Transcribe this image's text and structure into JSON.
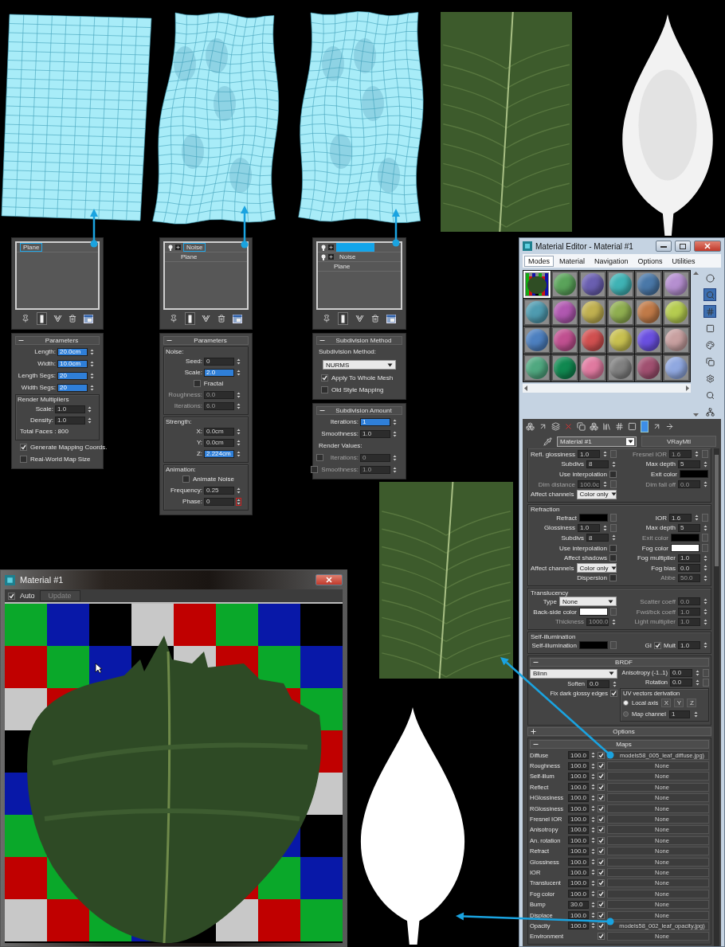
{
  "modifier_panels": [
    {
      "stack": [
        {
          "label": "Plane",
          "selected": true,
          "toggles": false
        }
      ],
      "rollouts": [
        {
          "title": "Parameters",
          "expanded": true,
          "rows": [
            {
              "kind": "spinner",
              "label": "Length:",
              "value": "20.0cm",
              "highlighted": true
            },
            {
              "kind": "spinner",
              "label": "Width:",
              "value": "10.0cm",
              "highlighted": true
            },
            {
              "kind": "spinner",
              "label": "Length Segs:",
              "value": "20",
              "highlighted": true
            },
            {
              "kind": "spinner",
              "label": "Width Segs:",
              "value": "20",
              "highlighted": true
            },
            {
              "kind": "group",
              "title": "Render Multipliers",
              "rows": [
                {
                  "kind": "spinner",
                  "label": "Scale:",
                  "value": "1.0",
                  "highlighted": false
                },
                {
                  "kind": "spinner",
                  "label": "Density:",
                  "value": "1.0",
                  "highlighted": false
                },
                {
                  "kind": "text",
                  "label": "Total Faces : 800"
                }
              ]
            },
            {
              "kind": "check",
              "label": "Generate Mapping Coords.",
              "checked": true
            },
            {
              "kind": "check",
              "label": "Real-World Map Size",
              "checked": false
            }
          ]
        }
      ]
    },
    {
      "stack": [
        {
          "label": "Noise",
          "selected": true,
          "toggles": true
        },
        {
          "label": "Plane",
          "selected": false,
          "toggles": false
        }
      ],
      "rollouts": [
        {
          "title": "Parameters",
          "expanded": true,
          "rows": [
            {
              "kind": "group",
              "title": "Noise:",
              "rows": [
                {
                  "kind": "spinner",
                  "label": "Seed:",
                  "value": "0",
                  "highlighted": false
                },
                {
                  "kind": "spinner",
                  "label": "Scale:",
                  "value": "2.0",
                  "highlighted": true
                },
                {
                  "kind": "check",
                  "label": "Fractal",
                  "checked": false
                },
                {
                  "kind": "spinner",
                  "label": "Roughness:",
                  "value": "0.0",
                  "highlighted": false,
                  "disabled": true
                },
                {
                  "kind": "spinner",
                  "label": "Iterations:",
                  "value": "6.0",
                  "highlighted": false,
                  "disabled": true
                }
              ]
            },
            {
              "kind": "group",
              "title": "Strength:",
              "rows": [
                {
                  "kind": "spinner",
                  "label": "X:",
                  "value": "0.0cm",
                  "highlighted": false
                },
                {
                  "kind": "spinner",
                  "label": "Y:",
                  "value": "0.0cm",
                  "highlighted": false
                },
                {
                  "kind": "spinner",
                  "label": "Z:",
                  "value": "2.224cm",
                  "highlighted": true
                }
              ]
            },
            {
              "kind": "group",
              "title": "Animation:",
              "rows": [
                {
                  "kind": "check",
                  "label": "Animate Noise",
                  "checked": false
                },
                {
                  "kind": "spinner",
                  "label": "Frequency:",
                  "value": "0.25",
                  "highlighted": false
                },
                {
                  "kind": "spinner",
                  "label": "Phase:",
                  "value": "0",
                  "highlighted": false,
                  "keyed": true
                }
              ]
            }
          ]
        }
      ]
    },
    {
      "stack": [
        {
          "selected": true,
          "toggles": true
        },
        {
          "label": "Noise",
          "selected": false,
          "toggles": true
        },
        {
          "label": "Plane",
          "selected": false,
          "toggles": false
        }
      ],
      "rollouts": [
        {
          "title": "Subdivision Method",
          "expanded": true,
          "rows": [
            {
              "kind": "text",
              "label": "Subdivision Method:"
            },
            {
              "kind": "dropdown",
              "value": "NURMS"
            },
            {
              "kind": "check",
              "label": "Apply To Whole Mesh",
              "checked": true
            },
            {
              "kind": "check",
              "label": "Old Style Mapping",
              "checked": false
            }
          ]
        },
        {
          "title": "Subdivision Amount",
          "expanded": true,
          "rows": [
            {
              "kind": "spinner",
              "label": "Iterations:",
              "value": "1",
              "highlighted": true
            },
            {
              "kind": "spinner",
              "label": "Smoothness:",
              "value": "1.0",
              "highlighted": false
            },
            {
              "kind": "text",
              "label": "Render Values:"
            },
            {
              "kind": "check-spinner",
              "checked": false,
              "label": "Iterations:",
              "value": "0",
              "disabled": true
            },
            {
              "kind": "check-spinner",
              "checked": false,
              "label": "Smoothness:",
              "value": "1.0",
              "disabled": true
            }
          ]
        }
      ]
    }
  ],
  "material_editor": {
    "title": "Material Editor - Material #1",
    "menu": [
      {
        "label": "Modes",
        "selected": true
      },
      {
        "label": "Material",
        "selected": false
      },
      {
        "label": "Navigation",
        "selected": false
      },
      {
        "label": "Options",
        "selected": false
      },
      {
        "label": "Utilities",
        "selected": false
      }
    ],
    "slots": [
      {
        "kind": "leaf",
        "selected": true
      },
      {
        "kind": "sphere",
        "color": "#5aa35a",
        "selected": false
      },
      {
        "kind": "sphere",
        "color": "#6a5fb0",
        "selected": false
      },
      {
        "kind": "sphere",
        "color": "#3fb3b5",
        "selected": false
      },
      {
        "kind": "sphere",
        "color": "#4a78a8",
        "selected": false
      },
      {
        "kind": "sphere",
        "color": "#b58fd0",
        "selected": false
      },
      {
        "kind": "sphere",
        "color": "#4f9bb0",
        "selected": false
      },
      {
        "kind": "sphere",
        "color": "#b058b0",
        "selected": false
      },
      {
        "kind": "sphere",
        "color": "#c0b050",
        "selected": false
      },
      {
        "kind": "sphere",
        "color": "#8fae50",
        "selected": false
      },
      {
        "kind": "sphere",
        "color": "#c07a48",
        "selected": false
      },
      {
        "kind": "sphere",
        "color": "#b5cc50",
        "selected": false
      },
      {
        "kind": "sphere",
        "color": "#4d80c0",
        "selected": false
      },
      {
        "kind": "sphere",
        "color": "#c05090",
        "selected": false
      },
      {
        "kind": "sphere",
        "color": "#d05050",
        "selected": false
      },
      {
        "kind": "sphere",
        "color": "#c8c050",
        "selected": false
      },
      {
        "kind": "sphere",
        "color": "#6a50e0",
        "selected": false
      },
      {
        "kind": "sphere",
        "color": "#c8a0a0",
        "selected": false
      },
      {
        "kind": "sphere",
        "color": "#50a880",
        "selected": false
      },
      {
        "kind": "sphere",
        "color": "#108850",
        "selected": false
      },
      {
        "kind": "sphere",
        "color": "#e07aa0",
        "selected": false
      },
      {
        "kind": "sphere",
        "color": "#808080",
        "selected": false
      },
      {
        "kind": "sphere",
        "color": "#a05070",
        "selected": false
      },
      {
        "kind": "sphere",
        "color": "#90a8e0",
        "selected": false
      }
    ],
    "material_name": "Material #1",
    "material_type": "VRayMtl",
    "sections": [
      {
        "rows": [
          {
            "items": [
              {
                "kind": "spinner",
                "label": "Refl. glossiness",
                "value": "1.0",
                "map_slot": true
              },
              {
                "kind": "spinner",
                "label": "Fresnel IOR",
                "value": "1.6",
                "disabled": true,
                "map_slot": true
              }
            ]
          },
          {
            "items": [
              {
                "kind": "spinner",
                "label": "Subdivs",
                "value": "8"
              },
              {
                "kind": "spinner",
                "label": "Max depth",
                "value": "5"
              }
            ]
          },
          {
            "items": [
              {
                "kind": "check",
                "label": "Use interpolation",
                "checked": false
              },
              {
                "kind": "swatch",
                "label": "Exit color",
                "color": "#000000"
              }
            ]
          },
          {
            "items": [
              {
                "kind": "spinner",
                "label": "Dim distance",
                "value": "100.0c",
                "disabled": true,
                "map_slot": true
              },
              {
                "kind": "spinner",
                "label": "Dim fall off",
                "value": "0.0",
                "disabled": true
              }
            ]
          },
          {
            "items": [
              {
                "kind": "dropdown",
                "label": "Affect channels",
                "value": "Color only"
              }
            ]
          }
        ]
      },
      {
        "title": "Refraction",
        "rows": [
          {
            "items": [
              {
                "kind": "swatch",
                "label": "Refract",
                "color": "#000000",
                "map_slot": true
              },
              {
                "kind": "spinner",
                "label": "IOR",
                "value": "1.6",
                "map_slot": true
              }
            ]
          },
          {
            "items": [
              {
                "kind": "spinner",
                "label": "Glossiness",
                "value": "1.0",
                "map_slot": true
              },
              {
                "kind": "spinner",
                "label": "Max depth",
                "value": "5"
              }
            ]
          },
          {
            "items": [
              {
                "kind": "spinner",
                "label": "Subdivs",
                "value": "8"
              },
              {
                "kind": "swatch",
                "label": "Exit color",
                "color": "#000000",
                "disabled": true,
                "map_slot": true
              }
            ]
          },
          {
            "items": [
              {
                "kind": "check",
                "label": "Use interpolation",
                "checked": false
              },
              {
                "kind": "swatch",
                "label": "Fog color",
                "color": "#ffffff",
                "map_slot": true
              }
            ]
          },
          {
            "items": [
              {
                "kind": "check",
                "label": "Affect shadows",
                "checked": false
              },
              {
                "kind": "spinner",
                "label": "Fog multiplier",
                "value": "1.0"
              }
            ]
          },
          {
            "items": [
              {
                "kind": "dropdown",
                "label": "Affect channels",
                "value": "Color only"
              },
              {
                "kind": "spinner",
                "label": "Fog bias",
                "value": "0.0"
              }
            ]
          },
          {
            "items": [
              {
                "kind": "check",
                "label": "Dispersion",
                "checked": false
              },
              {
                "kind": "spinner",
                "label": "Abbe",
                "value": "50.0",
                "disabled": true
              }
            ]
          }
        ]
      },
      {
        "title": "Translucency",
        "rows": [
          {
            "items": [
              {
                "kind": "dropdown",
                "label": "Type",
                "value": "None"
              },
              {
                "kind": "spinner",
                "label": "Scatter coeff",
                "value": "0.0",
                "disabled": true
              }
            ]
          },
          {
            "items": [
              {
                "kind": "swatch",
                "label": "Back-side color",
                "color": "#ffffff",
                "map_slot": true
              },
              {
                "kind": "spinner",
                "label": "Fwd/bck coeff",
                "value": "1.0",
                "disabled": true
              }
            ]
          },
          {
            "items": [
              {
                "kind": "spinner",
                "label": "Thickness",
                "value": "1000.0",
                "disabled": true
              },
              {
                "kind": "spinner",
                "label": "Light multiplier",
                "value": "1.0",
                "disabled": true
              }
            ]
          }
        ]
      },
      {
        "title": "Self-illumination",
        "rows": [
          {
            "items": [
              {
                "kind": "swatch",
                "label": "Self-illumination",
                "color": "#000000",
                "map_slot": true
              },
              {
                "kind": "check",
                "label": "GI",
                "checked": true
              },
              {
                "kind": "spinner",
                "label": "Mult",
                "value": "1.0"
              }
            ]
          }
        ]
      }
    ],
    "brdf": {
      "title": "BRDF",
      "expanded": true,
      "type": "Blinn",
      "soften": {
        "label": "Soften",
        "value": "0.0"
      },
      "fix_dark": {
        "label": "Fix dark glossy edges",
        "checked": true
      },
      "anisotropy": {
        "label": "Anisotropy (-1..1)",
        "value": "0.0",
        "map_slot": true
      },
      "rotation": {
        "label": "Rotation",
        "value": "0.0",
        "map_slot": true
      },
      "uv": {
        "title": "UV vectors derivation",
        "options": [
          {
            "label": "Local axis",
            "selected": true
          },
          {
            "label": "Map channel",
            "selected": false
          }
        ],
        "axes": [
          "X",
          "Y",
          "Z"
        ],
        "channel": "1"
      }
    },
    "options": {
      "title": "Options",
      "expanded": false
    },
    "maps": {
      "title": "Maps",
      "expanded": true,
      "rows": [
        {
          "label": "Diffuse",
          "amount": "100.0",
          "checked": true,
          "map": "models58_005_leaf_diffuse.jpg)"
        },
        {
          "label": "Roughness",
          "amount": "100.0",
          "checked": true,
          "map": "None"
        },
        {
          "label": "Self-illum",
          "amount": "100.0",
          "checked": true,
          "map": "None"
        },
        {
          "label": "Reflect",
          "amount": "100.0",
          "checked": true,
          "map": "None"
        },
        {
          "label": "HGlossiness",
          "amount": "100.0",
          "checked": true,
          "map": "None"
        },
        {
          "label": "RGlossiness",
          "amount": "100.0",
          "checked": true,
          "map": "None"
        },
        {
          "label": "Fresnel IOR",
          "amount": "100.0",
          "checked": true,
          "map": "None"
        },
        {
          "label": "Anisotropy",
          "amount": "100.0",
          "checked": true,
          "map": "None"
        },
        {
          "label": "An. rotation",
          "amount": "100.0",
          "checked": true,
          "map": "None"
        },
        {
          "label": "Refract",
          "amount": "100.0",
          "checked": true,
          "map": "None"
        },
        {
          "label": "Glossiness",
          "amount": "100.0",
          "checked": true,
          "map": "None"
        },
        {
          "label": "IOR",
          "amount": "100.0",
          "checked": true,
          "map": "None"
        },
        {
          "label": "Translucent",
          "amount": "100.0",
          "checked": true,
          "map": "None"
        },
        {
          "label": "Fog color",
          "amount": "100.0",
          "checked": true,
          "map": "None"
        },
        {
          "label": "Bump",
          "amount": "30.0",
          "checked": true,
          "map": "None"
        },
        {
          "label": "Displace",
          "amount": "100.0",
          "checked": true,
          "map": "None"
        },
        {
          "label": "Opacity",
          "amount": "100.0",
          "checked": true,
          "map": "models58_002_leaf_opacity.jpg)"
        },
        {
          "label": "Environment",
          "checked": true,
          "map": "None"
        }
      ]
    }
  },
  "preview_window": {
    "title": "Material #1",
    "auto": {
      "label": "Auto",
      "checked": true
    },
    "update": {
      "label": "Update",
      "disabled": true
    }
  }
}
